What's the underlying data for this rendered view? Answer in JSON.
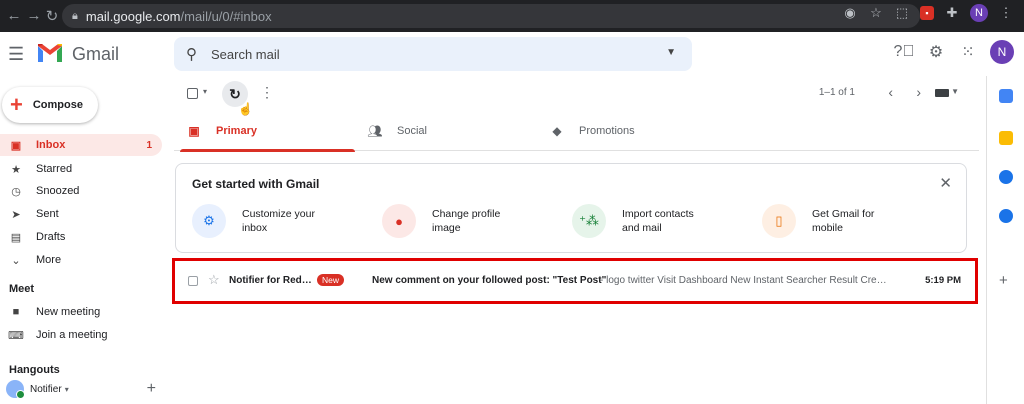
{
  "browser": {
    "url_host": "mail.google.com",
    "url_path": "/mail/u/0/#inbox",
    "profile_initial": "N"
  },
  "app": {
    "name": "Gmail"
  },
  "search": {
    "placeholder": "Search mail"
  },
  "account": {
    "initial": "N"
  },
  "compose": {
    "label": "Compose"
  },
  "sidebar": {
    "items": [
      {
        "label": "Inbox",
        "count": "1",
        "icon": "inbox-icon"
      },
      {
        "label": "Starred",
        "icon": "star-icon"
      },
      {
        "label": "Snoozed",
        "icon": "clock-icon"
      },
      {
        "label": "Sent",
        "icon": "send-icon"
      },
      {
        "label": "Drafts",
        "icon": "draft-icon"
      },
      {
        "label": "More",
        "icon": "chevron-down-icon"
      }
    ],
    "meet": {
      "title": "Meet",
      "items": [
        {
          "label": "New meeting",
          "icon": "video-icon"
        },
        {
          "label": "Join a meeting",
          "icon": "keyboard-icon"
        }
      ]
    },
    "hangouts": {
      "title": "Hangouts",
      "user": "Notifier"
    }
  },
  "toolbar": {
    "pager": "1–1 of 1"
  },
  "tabs": [
    {
      "label": "Primary",
      "icon": "inbox-icon"
    },
    {
      "label": "Social",
      "icon": "people-icon"
    },
    {
      "label": "Promotions",
      "icon": "tag-icon"
    }
  ],
  "get_started": {
    "title": "Get started with Gmail",
    "items": [
      {
        "line1": "Customize your",
        "line2": "inbox",
        "color": "#1a73e8",
        "bg": "#e8f0fe"
      },
      {
        "line1": "Change profile",
        "line2": "image",
        "color": "#d93025",
        "bg": "#fce8e6"
      },
      {
        "line1": "Import contacts",
        "line2": "and mail",
        "color": "#188038",
        "bg": "#e6f4ea"
      },
      {
        "line1": "Get Gmail for",
        "line2": "mobile",
        "color": "#e8710a",
        "bg": "#feefe3"
      }
    ]
  },
  "emails": [
    {
      "sender": "Notifier for Red…",
      "badge": "New",
      "subject": "New comment on your followed post: \"Test Post\"",
      "snippet": " - logo twitter Visit Dashboard New Instant Searcher Result Cre…",
      "time": "5:19 PM"
    }
  ],
  "colors": {
    "accent": "#d93025",
    "highlight_border": "#e00000"
  }
}
